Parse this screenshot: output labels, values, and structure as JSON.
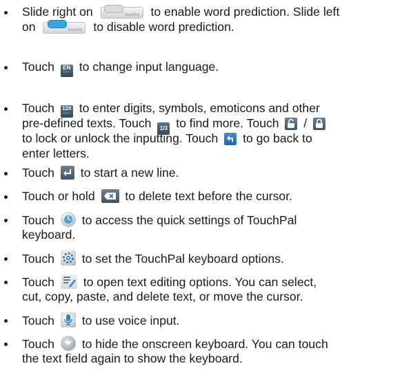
{
  "items": [
    {
      "l1a": "Slide right on",
      "l1b": "to enable word prediction. Slide left",
      "l2a": "on",
      "l2b": "to disable word prediction.",
      "slide_tag": "TouchPal"
    },
    {
      "a": "Touch",
      "b": "to change input language.",
      "icon_text": "EN"
    },
    {
      "l1a": "Touch",
      "l1b": "to enter digits, symbols, emoticons and other",
      "icon_text": "12#",
      "l2a": "pre-defined texts. Touch",
      "l2b": "to find more. Touch",
      "l2c": "/",
      "frac_text": "1/3",
      "l3": "to lock or unlock the inputting. Touch",
      "l3b": "to go back to",
      "l4": "enter letters."
    },
    {
      "a": "Touch",
      "b": "to start a new line."
    },
    {
      "a": "Touch or hold",
      "b": "to delete text before the cursor."
    },
    {
      "l1a": "Touch",
      "l1b": "to access the quick settings of TouchPal",
      "l2": "keyboard."
    },
    {
      "a": "Touch",
      "b": "to set the TouchPal keyboard options."
    },
    {
      "l1a": "Touch",
      "l1b": "to open text editing options. You can select,",
      "l2": "cut, copy, paste, and delete text, or move the cursor."
    },
    {
      "a": "Touch",
      "b": "to use voice input."
    },
    {
      "l1a": "Touch",
      "l1b": "to hide the onscreen keyboard. You can touch",
      "l2": "the text field again to show the keyboard."
    }
  ],
  "icons": [
    "slider-on-icon",
    "slider-off-icon",
    "en-language-icon",
    "number-symbol-icon",
    "page-fraction-icon",
    "unlock-icon",
    "lock-icon",
    "back-arrow-icon",
    "enter-icon",
    "delete-icon",
    "quick-settings-icon",
    "gear-icon",
    "text-edit-icon",
    "microphone-icon",
    "hide-keyboard-icon"
  ]
}
